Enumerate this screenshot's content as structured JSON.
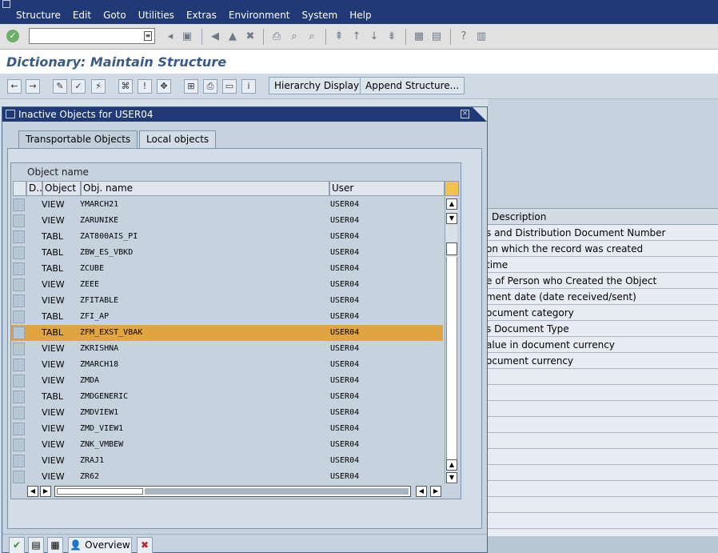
{
  "menubar": {
    "items": [
      "Structure",
      "Edit",
      "Goto",
      "Utilities",
      "Extras",
      "Environment",
      "System",
      "Help"
    ]
  },
  "toolbar": {
    "command_value": ""
  },
  "title": "Dictionary: Maintain Structure",
  "app_toolbar": {
    "hierarchy_label": "Hierarchy Display",
    "append_label": "Append Structure..."
  },
  "background_table": {
    "header": "Description",
    "rows": [
      "s and Distribution Document Number",
      "on which the record was created",
      " time",
      "e of Person who Created the Object",
      "ment date (date received/sent)",
      "ocument category",
      "s Document Type",
      "alue in document currency",
      "ocument currency"
    ]
  },
  "dialog": {
    "title": "Inactive Objects for USER04",
    "tabs": [
      "Transportable Objects",
      "Local objects"
    ],
    "active_tab": "Local objects",
    "grid_title": "Object name",
    "columns": [
      "D..",
      "Object",
      "Obj. name",
      "User"
    ],
    "rows": [
      {
        "object": "VIEW",
        "name": "YMARCH21",
        "user": "USER04"
      },
      {
        "object": "VIEW",
        "name": "ZARUNIKE",
        "user": "USER04"
      },
      {
        "object": "TABL",
        "name": "ZAT800AIS_PI",
        "user": "USER04"
      },
      {
        "object": "TABL",
        "name": "ZBW_ES_VBKD",
        "user": "USER04"
      },
      {
        "object": "TABL",
        "name": "ZCUBE",
        "user": "USER04"
      },
      {
        "object": "VIEW",
        "name": "ZEEE",
        "user": "USER04"
      },
      {
        "object": "VIEW",
        "name": "ZFITABLE",
        "user": "USER04"
      },
      {
        "object": "TABL",
        "name": "ZFI_AP",
        "user": "USER04"
      },
      {
        "object": "TABL",
        "name": "ZFM_EXST_VBAK",
        "user": "USER04"
      },
      {
        "object": "VIEW",
        "name": "ZKRISHNA",
        "user": "USER04"
      },
      {
        "object": "VIEW",
        "name": "ZMARCH18",
        "user": "USER04"
      },
      {
        "object": "VIEW",
        "name": "ZMDA",
        "user": "USER04"
      },
      {
        "object": "TABL",
        "name": "ZMDGENERIC",
        "user": "USER04"
      },
      {
        "object": "VIEW",
        "name": "ZMDVIEW1",
        "user": "USER04"
      },
      {
        "object": "VIEW",
        "name": "ZMD_VIEW1",
        "user": "USER04"
      },
      {
        "object": "VIEW",
        "name": "ZNK_VMBEW",
        "user": "USER04"
      },
      {
        "object": "VIEW",
        "name": "ZRAJ1",
        "user": "USER04"
      },
      {
        "object": "VIEW",
        "name": "ZR62",
        "user": "USER04"
      }
    ],
    "selected_row": 8,
    "footer": {
      "overview_label": "Overview"
    }
  }
}
